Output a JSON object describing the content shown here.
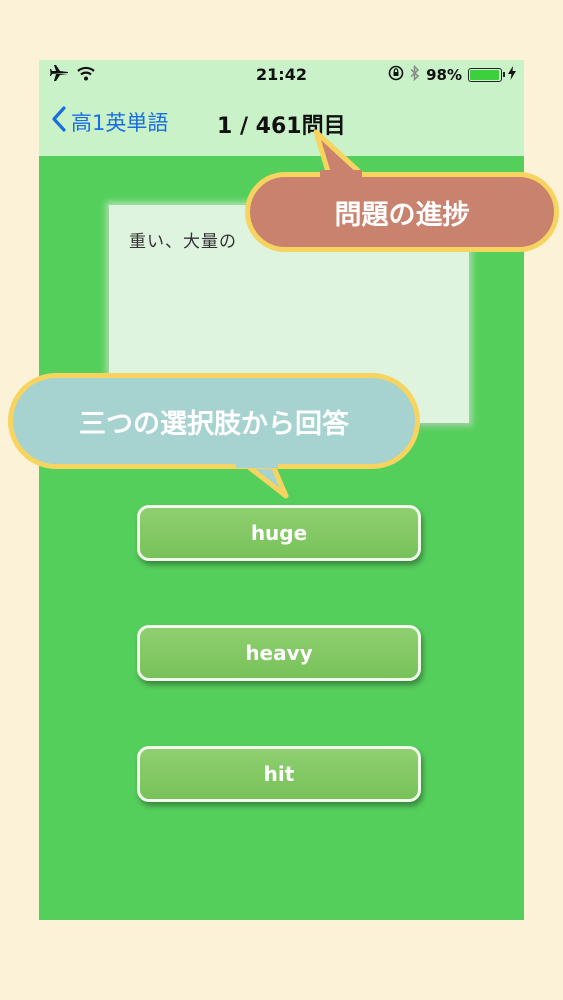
{
  "status_bar": {
    "time": "21:42",
    "battery_percent": "98%",
    "battery_level": 0.98,
    "icons": [
      "airplane-icon",
      "wifi-icon",
      "orientation-lock-icon",
      "bluetooth-icon",
      "battery-icon",
      "charging-icon"
    ]
  },
  "nav": {
    "back_label": "高1英単語",
    "title": "1 / 461問目"
  },
  "question": {
    "text": "重い、大量の"
  },
  "choices": [
    {
      "label": "huge"
    },
    {
      "label": "heavy"
    },
    {
      "label": "hit"
    }
  ],
  "callouts": {
    "progress": "問題の進捗",
    "answer": "三つの選択肢から回答"
  },
  "colors": {
    "page_background": "#fbf2d8",
    "app_background": "#55cf5c",
    "bar_background": "#c9f2c9",
    "button": "#85c866",
    "link": "#1a6de0",
    "callout_progress": "#c9826d",
    "callout_answer": "#a6d2cf",
    "callout_border": "#f7d460"
  }
}
